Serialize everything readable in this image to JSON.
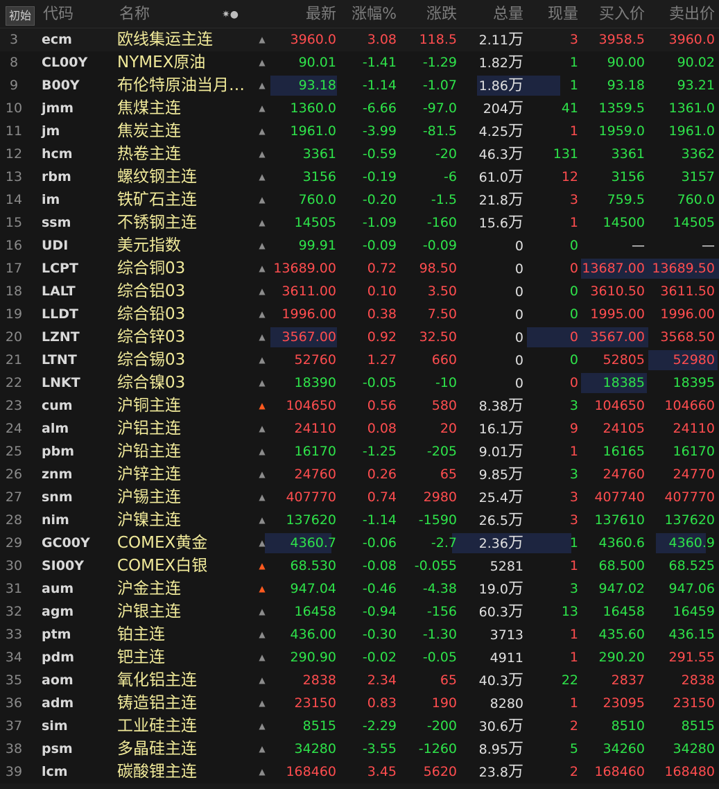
{
  "header": {
    "init_label": "初始",
    "code": "代码",
    "name": "名称",
    "star_icon": "✷●",
    "last": "最新",
    "pct": "涨幅%",
    "change": "涨跌",
    "volume": "总量",
    "current_volume": "现量",
    "bid": "买入价",
    "ask": "卖出价"
  },
  "colors": {
    "up": "#ff4d4f",
    "down": "#2ee34a",
    "name": "#f1ea9a",
    "bell_active": "#ff5a1f"
  },
  "rows": [
    {
      "no": "3",
      "code": "ecm",
      "name": "欧线集运主连",
      "bell": "",
      "last": "3960.0",
      "pct": "3.08",
      "chg": "118.5",
      "vol": "2.11",
      "vol_unit": "万",
      "cur": "3",
      "bid": "3958.5",
      "ask": "3960.0",
      "dir": "up"
    },
    {
      "no": "8",
      "code": "CL00Y",
      "name": "NYMEX原油",
      "bell": "",
      "last": "90.01",
      "pct": "-1.41",
      "chg": "-1.29",
      "vol": "1.82",
      "vol_unit": "万",
      "cur": "1",
      "bid": "90.00",
      "ask": "90.02",
      "dir": "dn"
    },
    {
      "no": "9",
      "code": "B00Y",
      "name": "布伦特原油当月…",
      "bell": "",
      "last": "93.18",
      "pct": "-1.14",
      "chg": "-1.07",
      "vol": "1.86",
      "vol_unit": "万",
      "cur": "1",
      "bid": "93.18",
      "ask": "93.21",
      "dir": "dn"
    },
    {
      "no": "10",
      "code": "jmm",
      "name": "焦煤主连",
      "bell": "",
      "last": "1360.0",
      "pct": "-6.66",
      "chg": "-97.0",
      "vol": "204",
      "vol_unit": "万",
      "cur": "41",
      "bid": "1359.5",
      "ask": "1361.0",
      "dir": "dn"
    },
    {
      "no": "11",
      "code": "jm",
      "name": "焦炭主连",
      "bell": "",
      "last": "1961.0",
      "pct": "-3.99",
      "chg": "-81.5",
      "vol": "4.25",
      "vol_unit": "万",
      "cur": "1",
      "bid": "1959.0",
      "ask": "1961.0",
      "dir": "dn",
      "cur_dir": "up"
    },
    {
      "no": "12",
      "code": "hcm",
      "name": "热卷主连",
      "bell": "",
      "last": "3361",
      "pct": "-0.59",
      "chg": "-20",
      "vol": "46.3",
      "vol_unit": "万",
      "cur": "131",
      "bid": "3361",
      "ask": "3362",
      "dir": "dn"
    },
    {
      "no": "13",
      "code": "rbm",
      "name": "螺纹钢主连",
      "bell": "",
      "last": "3156",
      "pct": "-0.19",
      "chg": "-6",
      "vol": "61.0",
      "vol_unit": "万",
      "cur": "12",
      "bid": "3156",
      "ask": "3157",
      "dir": "dn",
      "cur_dir": "up"
    },
    {
      "no": "14",
      "code": "im",
      "name": "铁矿石主连",
      "bell": "",
      "last": "760.0",
      "pct": "-0.20",
      "chg": "-1.5",
      "vol": "21.8",
      "vol_unit": "万",
      "cur": "3",
      "bid": "759.5",
      "ask": "760.0",
      "dir": "dn",
      "cur_dir": "up"
    },
    {
      "no": "15",
      "code": "ssm",
      "name": "不锈钢主连",
      "bell": "",
      "last": "14505",
      "pct": "-1.09",
      "chg": "-160",
      "vol": "15.6",
      "vol_unit": "万",
      "cur": "1",
      "bid": "14500",
      "ask": "14505",
      "dir": "dn",
      "cur_dir": "up"
    },
    {
      "no": "16",
      "code": "UDI",
      "name": "美元指数",
      "bell": "",
      "last": "99.91",
      "pct": "-0.09",
      "chg": "-0.09",
      "vol": "0",
      "vol_unit": "",
      "cur": "0",
      "bid": "—",
      "ask": "—",
      "dir": "dn",
      "quote_dir": "ne"
    },
    {
      "no": "17",
      "code": "LCPT",
      "name": "综合铜03",
      "bell": "",
      "last": "13689.00",
      "pct": "0.72",
      "chg": "98.50",
      "vol": "0",
      "vol_unit": "",
      "cur": "0",
      "bid": "13687.00",
      "ask": "13689.50",
      "dir": "up"
    },
    {
      "no": "18",
      "code": "LALT",
      "name": "综合铝03",
      "bell": "",
      "last": "3611.00",
      "pct": "0.10",
      "chg": "3.50",
      "vol": "0",
      "vol_unit": "",
      "cur": "0",
      "bid": "3610.50",
      "ask": "3611.50",
      "dir": "up",
      "cur_dir": "dn"
    },
    {
      "no": "19",
      "code": "LLDT",
      "name": "综合铅03",
      "bell": "",
      "last": "1996.00",
      "pct": "0.38",
      "chg": "7.50",
      "vol": "0",
      "vol_unit": "",
      "cur": "0",
      "bid": "1995.00",
      "ask": "1996.00",
      "dir": "up",
      "cur_dir": "dn"
    },
    {
      "no": "20",
      "code": "LZNT",
      "name": "综合锌03",
      "bell": "",
      "last": "3567.00",
      "pct": "0.92",
      "chg": "32.50",
      "vol": "0",
      "vol_unit": "",
      "cur": "0",
      "bid": "3567.00",
      "ask": "3568.50",
      "dir": "up"
    },
    {
      "no": "21",
      "code": "LTNT",
      "name": "综合锡03",
      "bell": "",
      "last": "52760",
      "pct": "1.27",
      "chg": "660",
      "vol": "0",
      "vol_unit": "",
      "cur": "0",
      "bid": "52805",
      "ask": "52980",
      "dir": "up",
      "cur_dir": "dn"
    },
    {
      "no": "22",
      "code": "LNKT",
      "name": "综合镍03",
      "bell": "",
      "last": "18390",
      "pct": "-0.05",
      "chg": "-10",
      "vol": "0",
      "vol_unit": "",
      "cur": "0",
      "bid": "18385",
      "ask": "18395",
      "dir": "dn",
      "cur_dir": "up"
    },
    {
      "no": "23",
      "code": "cum",
      "name": "沪铜主连",
      "bell": "on",
      "last": "104650",
      "pct": "0.56",
      "chg": "580",
      "vol": "8.38",
      "vol_unit": "万",
      "cur": "3",
      "bid": "104650",
      "ask": "104660",
      "dir": "up",
      "cur_dir": "dn"
    },
    {
      "no": "24",
      "code": "alm",
      "name": "沪铝主连",
      "bell": "",
      "last": "24110",
      "pct": "0.08",
      "chg": "20",
      "vol": "16.1",
      "vol_unit": "万",
      "cur": "9",
      "bid": "24105",
      "ask": "24110",
      "dir": "up"
    },
    {
      "no": "25",
      "code": "pbm",
      "name": "沪铅主连",
      "bell": "",
      "last": "16170",
      "pct": "-1.25",
      "chg": "-205",
      "vol": "9.01",
      "vol_unit": "万",
      "cur": "1",
      "bid": "16165",
      "ask": "16170",
      "dir": "dn",
      "cur_dir": "up"
    },
    {
      "no": "26",
      "code": "znm",
      "name": "沪锌主连",
      "bell": "",
      "last": "24760",
      "pct": "0.26",
      "chg": "65",
      "vol": "9.85",
      "vol_unit": "万",
      "cur": "3",
      "bid": "24760",
      "ask": "24770",
      "dir": "up",
      "cur_dir": "dn"
    },
    {
      "no": "27",
      "code": "snm",
      "name": "沪锡主连",
      "bell": "",
      "last": "407770",
      "pct": "0.74",
      "chg": "2980",
      "vol": "25.4",
      "vol_unit": "万",
      "cur": "3",
      "bid": "407740",
      "ask": "407770",
      "dir": "up"
    },
    {
      "no": "28",
      "code": "nim",
      "name": "沪镍主连",
      "bell": "",
      "last": "137620",
      "pct": "-1.14",
      "chg": "-1590",
      "vol": "26.5",
      "vol_unit": "万",
      "cur": "3",
      "bid": "137610",
      "ask": "137620",
      "dir": "dn",
      "cur_dir": "up"
    },
    {
      "no": "29",
      "code": "GC00Y",
      "name": "COMEX黄金",
      "bell": "",
      "last": "4360.7",
      "pct": "-0.06",
      "chg": "-2.7",
      "vol": "2.36",
      "vol_unit": "万",
      "cur": "1",
      "bid": "4360.6",
      "ask": "4360.9",
      "dir": "dn"
    },
    {
      "no": "30",
      "code": "SI00Y",
      "name": "COMEX白银",
      "bell": "on",
      "last": "68.530",
      "pct": "-0.08",
      "chg": "-0.055",
      "vol": "5281",
      "vol_unit": "",
      "cur": "1",
      "bid": "68.500",
      "ask": "68.525",
      "dir": "dn",
      "cur_dir": "up"
    },
    {
      "no": "31",
      "code": "aum",
      "name": "沪金主连",
      "bell": "on",
      "last": "947.04",
      "pct": "-0.46",
      "chg": "-4.38",
      "vol": "19.0",
      "vol_unit": "万",
      "cur": "3",
      "bid": "947.02",
      "ask": "947.06",
      "dir": "dn"
    },
    {
      "no": "32",
      "code": "agm",
      "name": "沪银主连",
      "bell": "",
      "last": "16458",
      "pct": "-0.94",
      "chg": "-156",
      "vol": "60.3",
      "vol_unit": "万",
      "cur": "13",
      "bid": "16458",
      "ask": "16459",
      "dir": "dn"
    },
    {
      "no": "33",
      "code": "ptm",
      "name": "铂主连",
      "bell": "",
      "last": "436.00",
      "pct": "-0.30",
      "chg": "-1.30",
      "vol": "3713",
      "vol_unit": "",
      "cur": "1",
      "bid": "435.60",
      "ask": "436.15",
      "dir": "dn",
      "cur_dir": "up"
    },
    {
      "no": "34",
      "code": "pdm",
      "name": "钯主连",
      "bell": "",
      "last": "290.90",
      "pct": "-0.02",
      "chg": "-0.05",
      "vol": "4911",
      "vol_unit": "",
      "cur": "1",
      "bid": "290.20",
      "ask": "291.55",
      "dir": "dn",
      "cur_dir": "up",
      "ask_dir": "up"
    },
    {
      "no": "35",
      "code": "aom",
      "name": "氧化铝主连",
      "bell": "",
      "last": "2838",
      "pct": "2.34",
      "chg": "65",
      "vol": "40.3",
      "vol_unit": "万",
      "cur": "22",
      "bid": "2837",
      "ask": "2838",
      "dir": "up",
      "cur_dir": "dn"
    },
    {
      "no": "36",
      "code": "adm",
      "name": "铸造铝主连",
      "bell": "",
      "last": "23150",
      "pct": "0.83",
      "chg": "190",
      "vol": "8280",
      "vol_unit": "",
      "cur": "1",
      "bid": "23095",
      "ask": "23150",
      "dir": "up"
    },
    {
      "no": "37",
      "code": "sim",
      "name": "工业硅主连",
      "bell": "",
      "last": "8515",
      "pct": "-2.29",
      "chg": "-200",
      "vol": "30.6",
      "vol_unit": "万",
      "cur": "2",
      "bid": "8510",
      "ask": "8515",
      "dir": "dn",
      "cur_dir": "up"
    },
    {
      "no": "38",
      "code": "psm",
      "name": "多晶硅主连",
      "bell": "",
      "last": "34280",
      "pct": "-3.55",
      "chg": "-1260",
      "vol": "8.95",
      "vol_unit": "万",
      "cur": "5",
      "bid": "34260",
      "ask": "34280",
      "dir": "dn"
    },
    {
      "no": "39",
      "code": "lcm",
      "name": "碳酸锂主连",
      "bell": "",
      "last": "168460",
      "pct": "3.45",
      "chg": "5620",
      "vol": "23.8",
      "vol_unit": "万",
      "cur": "2",
      "bid": "168460",
      "ask": "168480",
      "dir": "up"
    }
  ]
}
